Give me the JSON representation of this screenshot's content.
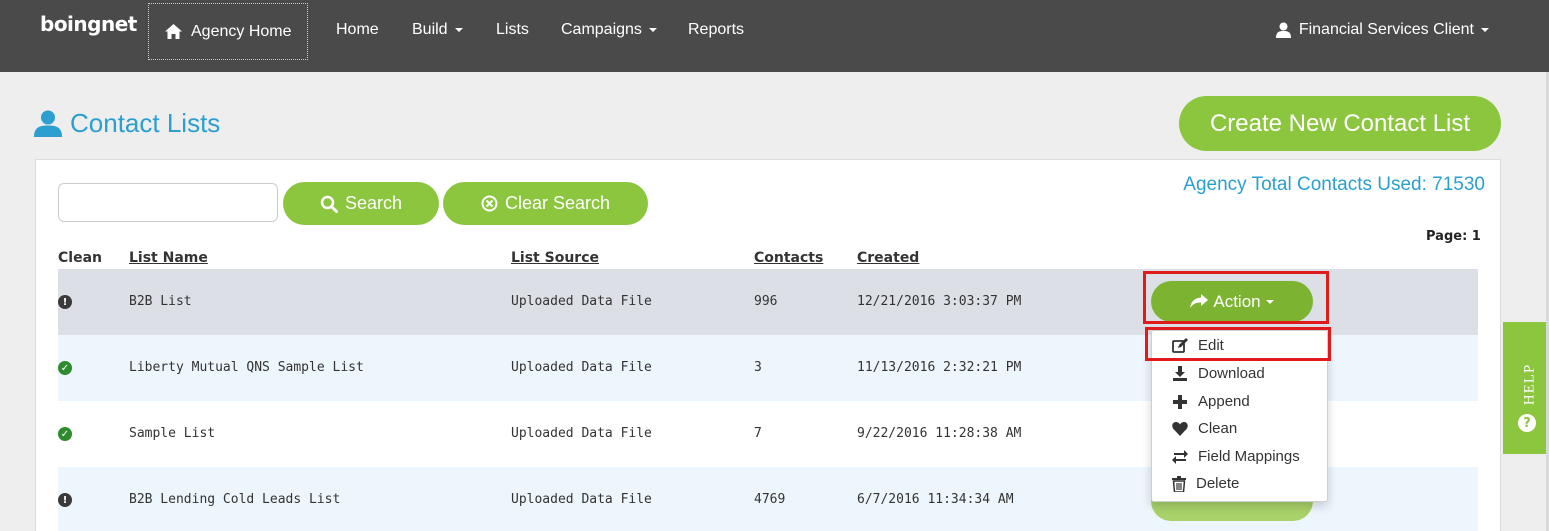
{
  "nav": {
    "logo": "boingnet",
    "agency_home": "Agency Home",
    "items": [
      "Home",
      "Build",
      "Lists",
      "Campaigns",
      "Reports"
    ],
    "user": "Financial Services Client"
  },
  "page": {
    "title": "Contact Lists",
    "create_button": "Create New Contact List",
    "total_contacts": "Agency Total Contacts Used: 71530",
    "page_label": "Page: 1"
  },
  "search": {
    "value": "",
    "search_button": "Search",
    "clear_button": "Clear Search"
  },
  "table": {
    "headers": [
      "Clean",
      "List Name",
      "List Source",
      "Contacts",
      "Created"
    ],
    "rows": [
      {
        "clean": "warning",
        "name": "B2B List",
        "source": "Uploaded Data File",
        "contacts": "996",
        "created": "12/21/2016 3:03:37 PM",
        "bg": "#dce0e6"
      },
      {
        "clean": "ok",
        "name": "Liberty Mutual QNS Sample List",
        "source": "Uploaded Data File",
        "contacts": "3",
        "created": "11/13/2016 2:32:21 PM",
        "bg": "#eef6fd"
      },
      {
        "clean": "ok",
        "name": "Sample List",
        "source": "Uploaded Data File",
        "contacts": "7",
        "created": "9/22/2016 11:28:38 AM",
        "bg": "#ffffff"
      },
      {
        "clean": "warning",
        "name": "B2B Lending Cold Leads List",
        "source": "Uploaded Data File",
        "contacts": "4769",
        "created": "6/7/2016 11:34:34 AM",
        "bg": "#eef6fd"
      }
    ]
  },
  "action": {
    "label": "Action",
    "menu": [
      {
        "label": "Edit",
        "icon": "edit-icon"
      },
      {
        "label": "Download",
        "icon": "download-icon"
      },
      {
        "label": "Append",
        "icon": "plus-icon"
      },
      {
        "label": "Clean",
        "icon": "heart-icon"
      },
      {
        "label": "Field Mappings",
        "icon": "swap-icon"
      },
      {
        "label": "Delete",
        "icon": "trash-icon"
      }
    ]
  },
  "help": {
    "label": "HELP",
    "q": "?"
  },
  "colors": {
    "nav_bg": "#4a4a4a",
    "accent_green": "#8cc63f",
    "accent_blue": "#2a9fd0",
    "highlight_red": "#e01b1b"
  }
}
